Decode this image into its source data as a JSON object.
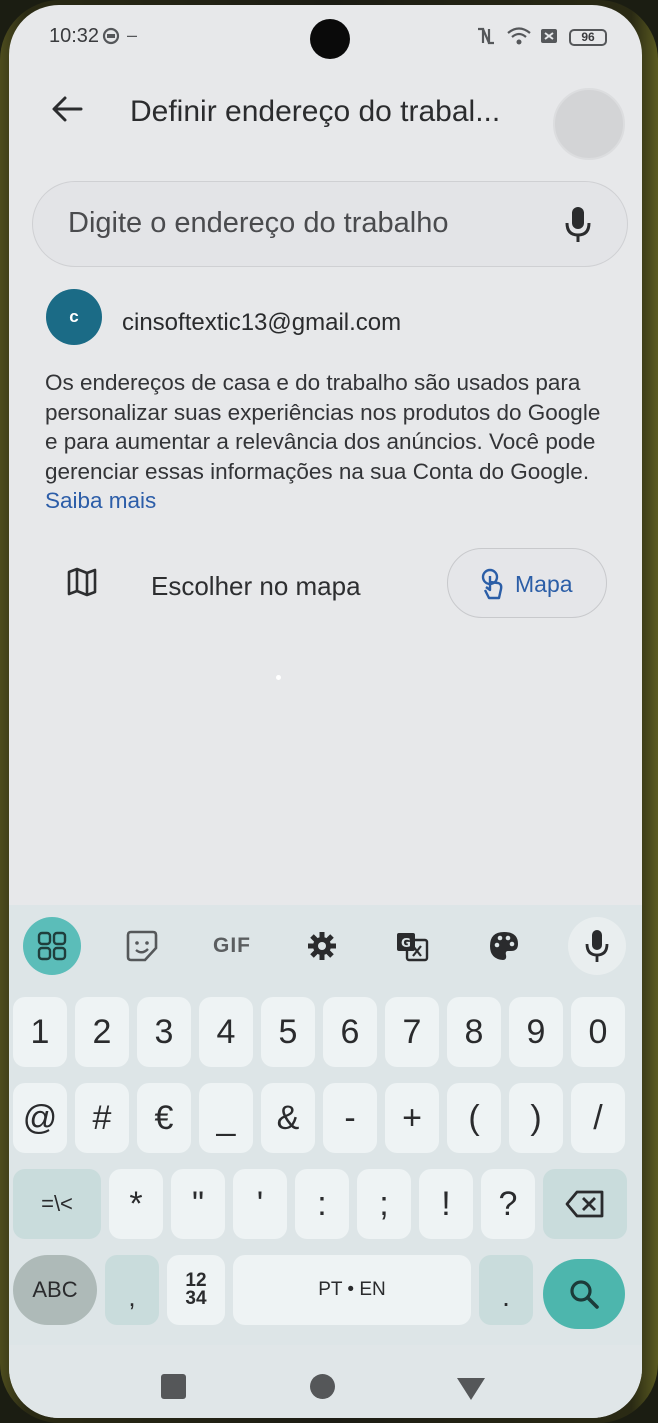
{
  "status_bar": {
    "time": "10:32",
    "battery": "96"
  },
  "header": {
    "title": "Definir endereço do trabal..."
  },
  "search": {
    "placeholder": "Digite o endereço do trabalho"
  },
  "account": {
    "initial": "c",
    "email": "cinsoftextic13@gmail.com"
  },
  "info": {
    "text": "Os endereços de casa e do trabalho são usados para personalizar suas experiências nos produtos do Google e para aumentar a relevância dos anúncios. Você pode gerenciar essas informações na sua Conta do Google. ",
    "link": "Saiba mais"
  },
  "choose_map": {
    "label": "Escolher no mapa",
    "chip_label": "Mapa"
  },
  "keyboard": {
    "toolbar": [
      "apps-grid-icon",
      "sticker-icon",
      "GIF",
      "gear-icon",
      "translate-icon",
      "palette-icon",
      "mic-icon"
    ],
    "row1": [
      "1",
      "2",
      "3",
      "4",
      "5",
      "6",
      "7",
      "8",
      "9",
      "0"
    ],
    "row2": [
      "@",
      "#",
      "€",
      "_",
      "&",
      "-",
      "+",
      "(",
      ")",
      "/"
    ],
    "row3": [
      "=\\<",
      "*",
      "\"",
      "'",
      ":",
      ";",
      "!",
      "?"
    ],
    "row4": {
      "abc": "ABC",
      "comma": ",",
      "num_top": "12",
      "num_bottom": "34",
      "space": "PT • EN",
      "period": "."
    }
  },
  "colors": {
    "accent": "#4db6ad",
    "link": "#2c5da8",
    "account_avatar": "#1b6b86"
  }
}
